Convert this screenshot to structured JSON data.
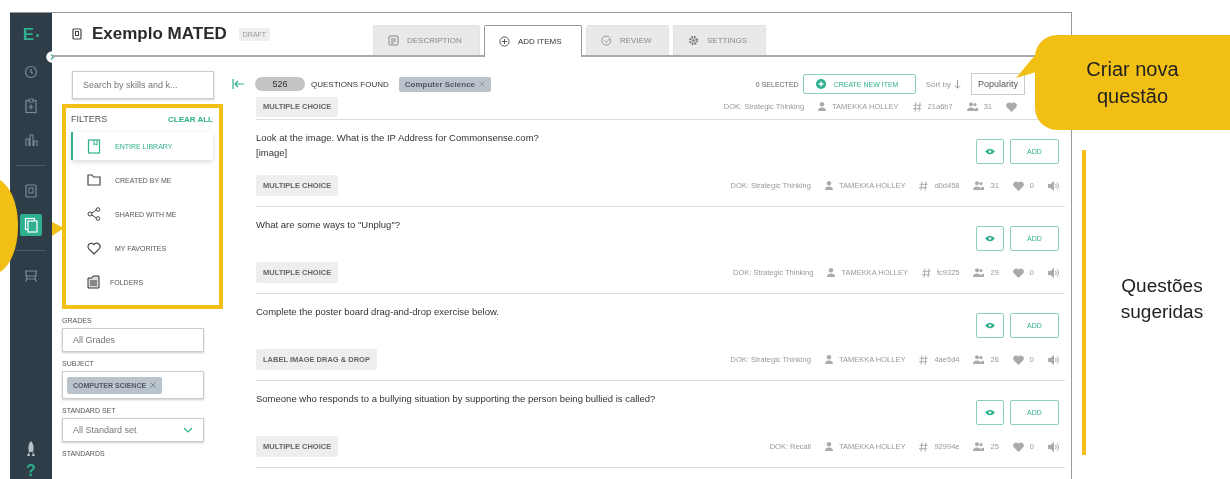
{
  "nav": {
    "logo": "E",
    "top": [
      {
        "selected": false
      },
      {
        "selected": false
      },
      {
        "selected": false
      }
    ],
    "middle": [
      {
        "selected": false
      },
      {
        "selected": true
      }
    ],
    "lower": [
      {
        "selected": false
      }
    ],
    "help": "?"
  },
  "header": {
    "title": "Exemplo MATED",
    "badge": "DRAFT"
  },
  "tabs": [
    {
      "label": "DESCRIPTION",
      "selected": false
    },
    {
      "label": "ADD ITEMS",
      "selected": true
    },
    {
      "label": "REVIEW",
      "selected": false
    },
    {
      "label": "SETTINGS",
      "selected": false
    }
  ],
  "sidebar": {
    "search_placeholder": "Search by skills and k...",
    "filters": {
      "title": "FILTERS",
      "clear": "CLEAR ALL",
      "items": [
        {
          "label": "ENTIRE LIBRARY",
          "selected": true
        },
        {
          "label": "CREATED BY ME",
          "selected": false
        },
        {
          "label": "SHARED WITH ME",
          "selected": false
        },
        {
          "label": "MY FAVORITES",
          "selected": false
        },
        {
          "label": "FOLDERS",
          "selected": false
        }
      ]
    },
    "grades": {
      "label": "GRADES",
      "placeholder": "All Grades"
    },
    "subject": {
      "label": "SUBJECT",
      "chips": [
        "COMPUTER SCIENCE"
      ]
    },
    "standard_set": {
      "label": "STANDARD SET",
      "value": "All Standard set"
    },
    "standards": {
      "label": "STANDARDS"
    }
  },
  "toolbar": {
    "count": "526",
    "found": "QUESTIONS FOUND",
    "chips": [
      "Computer Science"
    ],
    "selected": "0 SELECTED",
    "create": "CREATE NEW ITEM",
    "sort_label": "Sort by",
    "sort_value": "Popularity"
  },
  "questions": [
    {
      "partial": true,
      "type": "MULTIPLE CHOICE",
      "dok": "DOK: Strategic Thinking",
      "author": "TAMEKKA HOLLEY",
      "id": "21a6b7",
      "count": "31"
    },
    {
      "partial": false,
      "lines": [
        "Look at the image. What is the IP Address for Commonsense.com?",
        "[image]"
      ],
      "add": "ADD",
      "type": "MULTIPLE CHOICE",
      "dok": "DOK: Strategic Thinking",
      "author": "TAMEKKA HOLLEY",
      "id": "d0d458",
      "count": "31",
      "likes": "0"
    },
    {
      "partial": false,
      "lines": [
        "What are some ways to \"Unplug\"?"
      ],
      "add": "ADD",
      "type": "MULTIPLE CHOICE",
      "dok": "DOK: Strategic Thinking",
      "author": "TAMEKKA HOLLEY",
      "id": "fc9325",
      "count": "29",
      "likes": "0"
    },
    {
      "partial": false,
      "lines": [
        "Complete the poster board drag-and-drop exercise below."
      ],
      "add": "ADD",
      "type": "LABEL IMAGE DRAG & DROP",
      "dok": "DOK: Strategic Thinking",
      "author": "TAMEKKA HOLLEY",
      "id": "4ae5d4",
      "count": "26",
      "likes": "0"
    },
    {
      "partial": false,
      "lines": [
        "Someone who responds to a bullying situation by supporting the person being bullied is called?"
      ],
      "add": "ADD",
      "type": "MULTIPLE CHOICE",
      "dok": "DOK: Recall",
      "author": "TAMEKKA HOLLEY",
      "id": "92994e",
      "count": "25",
      "likes": "0"
    }
  ],
  "annotations": {
    "create_callout": "Criar nova questão",
    "suggested_label": "Questões sugeridas"
  }
}
